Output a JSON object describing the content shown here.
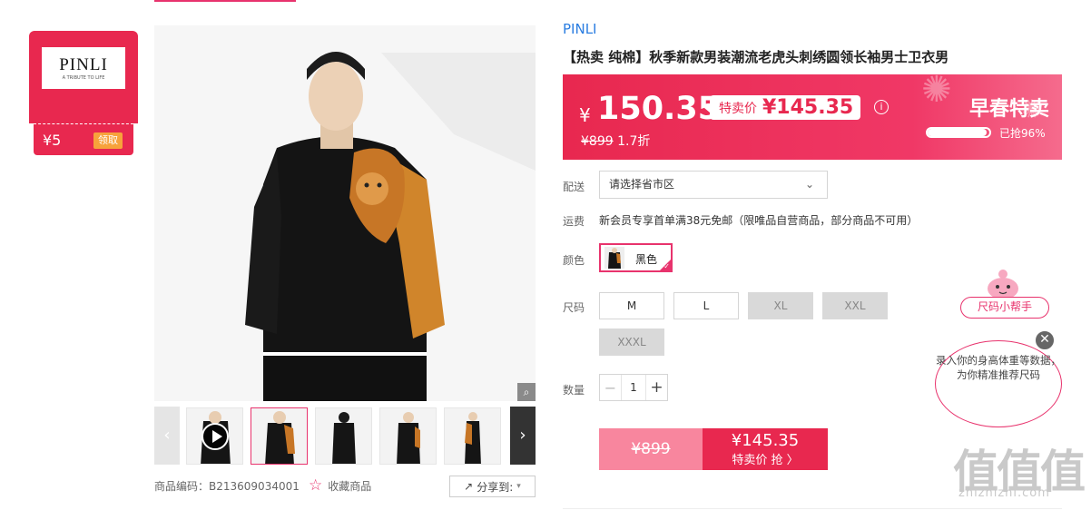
{
  "brand": {
    "logo_text": "PINLI",
    "logo_tagline": "A TRIBUTE TO LIFE",
    "coupon_value": "¥5",
    "coupon_action": "领取"
  },
  "product": {
    "brand_link": "PINLI",
    "title": "【热卖 纯棉】秋季新款男装潮流老虎头刺绣圆领长袖男士卫衣男",
    "sku_label": "商品编码：",
    "sku": "B213609034001",
    "fav_label": "收藏商品",
    "share_label": "分享到:"
  },
  "price": {
    "currency": "¥",
    "current": "150.35",
    "special_label": "特卖价",
    "special_value": "¥145.35",
    "original": "¥899",
    "discount": "1.7折",
    "promo_name": "早春特卖",
    "sold_text": "已抢96%",
    "sold_percent": 96
  },
  "options": {
    "delivery_label": "配送",
    "delivery_placeholder": "请选择省市区",
    "shipping_label": "运费",
    "shipping_text": "新会员专享首单满38元免邮（限唯品自营商品，部分商品不可用）",
    "color_label": "颜色",
    "color_value": "黑色",
    "size_label": "尺码",
    "sizes": [
      {
        "label": "M",
        "disabled": false
      },
      {
        "label": "L",
        "disabled": false
      },
      {
        "label": "XL",
        "disabled": true
      },
      {
        "label": "XXL",
        "disabled": true
      },
      {
        "label": "XXXL",
        "disabled": true
      }
    ],
    "qty_label": "数量",
    "qty_value": "1"
  },
  "buy": {
    "original": "¥899",
    "price": "¥145.35",
    "action": "特卖价 抢 〉"
  },
  "helper": {
    "button": "尺码小帮手",
    "bubble": "录入你的身高体重等数据，为你精准推荐尺码"
  },
  "watermark": {
    "text": "值值值",
    "domain": "zhizhizhi.com"
  },
  "colors": {
    "accent": "#e8336d",
    "price_red": "#e8284f",
    "link": "#2a7de1"
  }
}
